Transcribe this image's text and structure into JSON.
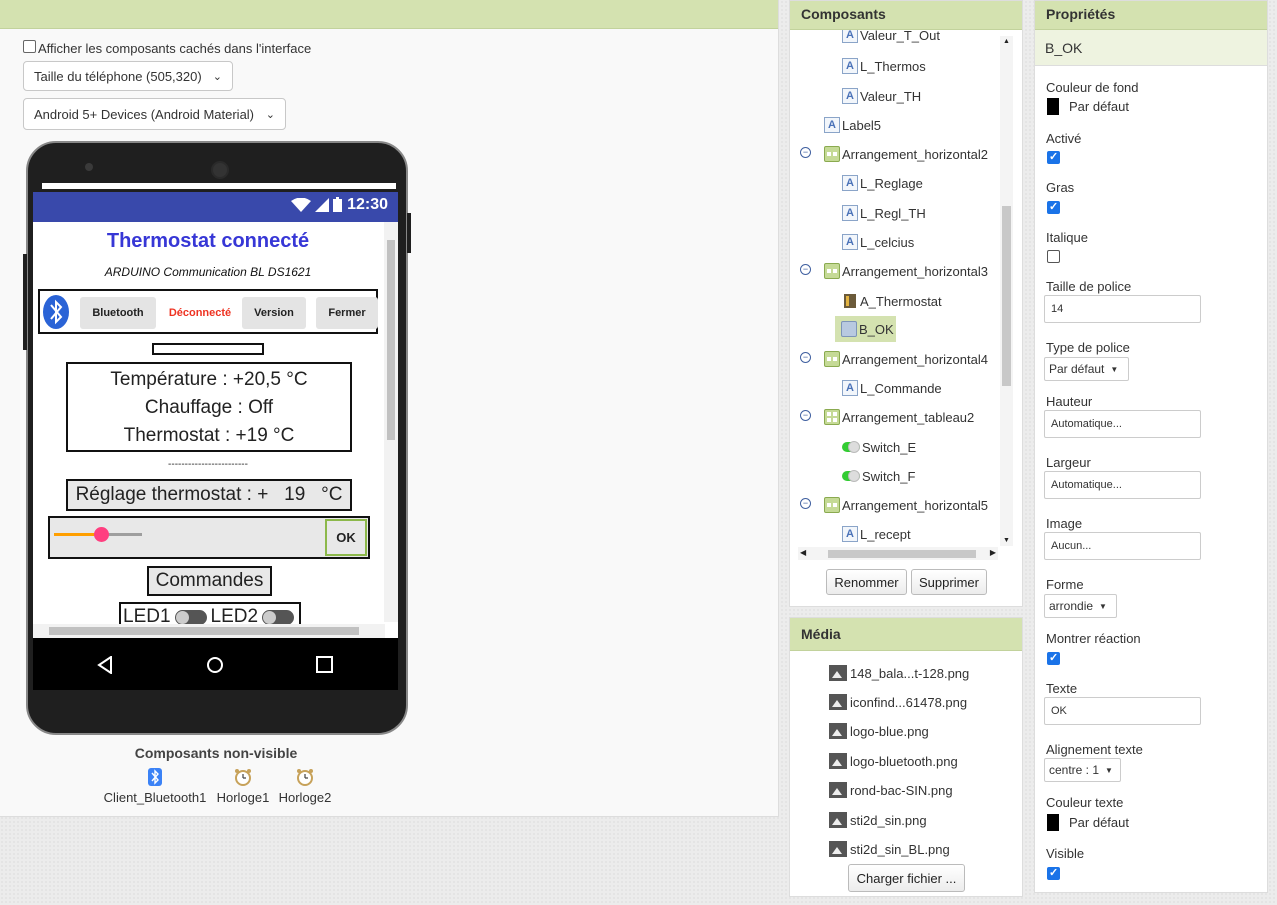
{
  "viewer": {
    "show_hidden_label": "Afficher les composants cachés dans l'interface",
    "phone_size": "Taille du téléphone (505,320)",
    "theme": "Android 5+ Devices (Android Material)"
  },
  "phone": {
    "time": "12:30",
    "app_title": "Thermostat connecté",
    "app_subtitle": "ARDUINO Communication BL DS1621",
    "bt_buttons": {
      "bluetooth": "Bluetooth",
      "status": "Déconnecté",
      "version": "Version",
      "close": "Fermer"
    },
    "info_lines": [
      "Température : +20,5 °C",
      "Chauffage : Off",
      "Thermostat : +19 °C"
    ],
    "separator": "------------------------",
    "reglage": "Réglage thermostat : +   19   °C",
    "slider_fraction": 0.53,
    "ok_label": "OK",
    "commandes": "Commandes",
    "led1": "LED1",
    "led2": "LED2"
  },
  "non_visible": {
    "title": "Composants non-visible",
    "items": [
      {
        "label": "Client_Bluetooth1",
        "icon": "bluetooth-icon"
      },
      {
        "label": "Horloge1",
        "icon": "clock-icon"
      },
      {
        "label": "Horloge2",
        "icon": "clock-icon"
      }
    ]
  },
  "components": {
    "title": "Composants",
    "items": [
      {
        "label": "Valeur_T_Out",
        "icon": "label"
      },
      {
        "label": "L_Thermos",
        "icon": "label"
      },
      {
        "label": "Valeur_TH",
        "icon": "label"
      },
      {
        "label": "Label5",
        "icon": "label"
      },
      {
        "label": "Arrangement_horizontal2",
        "icon": "horizontal-arrangement"
      },
      {
        "label": "L_Reglage",
        "icon": "label"
      },
      {
        "label": "L_Regl_TH",
        "icon": "label"
      },
      {
        "label": "L_celcius",
        "icon": "label"
      },
      {
        "label": "Arrangement_horizontal3",
        "icon": "horizontal-arrangement"
      },
      {
        "label": "A_Thermostat",
        "icon": "image"
      },
      {
        "label": "B_OK",
        "icon": "button"
      },
      {
        "label": "Arrangement_horizontal4",
        "icon": "horizontal-arrangement"
      },
      {
        "label": "L_Commande",
        "icon": "label"
      },
      {
        "label": "Arrangement_tableau2",
        "icon": "table-arrangement"
      },
      {
        "label": "Switch_E",
        "icon": "switch"
      },
      {
        "label": "Switch_F",
        "icon": "switch"
      },
      {
        "label": "Arrangement_horizontal5",
        "icon": "horizontal-arrangement"
      },
      {
        "label": "L_recept",
        "icon": "label"
      }
    ],
    "selected": "B_OK",
    "rename_button": "Renommer",
    "delete_button": "Supprimer"
  },
  "media": {
    "title": "Média",
    "files": [
      "148_bala...t-128.png",
      "iconfind...61478.png",
      "logo-blue.png",
      "logo-bluetooth.png",
      "rond-bac-SIN.png",
      "sti2d_sin.png",
      "sti2d_sin_BL.png"
    ],
    "upload_button": "Charger fichier ..."
  },
  "properties": {
    "title": "Propriétés",
    "component": "B_OK",
    "background_color_label": "Couleur de fond",
    "background_color_value": "Par défaut",
    "enabled_label": "Activé",
    "enabled": true,
    "bold_label": "Gras",
    "bold": true,
    "italic_label": "Italique",
    "italic": false,
    "font_size_label": "Taille de police",
    "font_size_value": "14",
    "font_type_label": "Type de police",
    "font_type_value": "Par défaut",
    "height_label": "Hauteur",
    "height_value": "Automatique...",
    "width_label": "Largeur",
    "width_value": "Automatique...",
    "image_label": "Image",
    "image_value": "Aucun...",
    "shape_label": "Forme",
    "shape_value": "arrondie",
    "show_feedback_label": "Montrer réaction",
    "show_feedback": true,
    "text_label": "Texte",
    "text_value": "OK",
    "text_align_label": "Alignement texte",
    "text_align_value": "centre : 1",
    "text_color_label": "Couleur texte",
    "text_color_value": "Par défaut",
    "visible_label": "Visible",
    "visible": true
  },
  "colors": {
    "header_green": "#d4e2b0",
    "app_title_blue": "#3737d6",
    "statusbar": "#3949ab",
    "status_red": "#e32222",
    "checkbox_blue": "#1a73e8"
  }
}
